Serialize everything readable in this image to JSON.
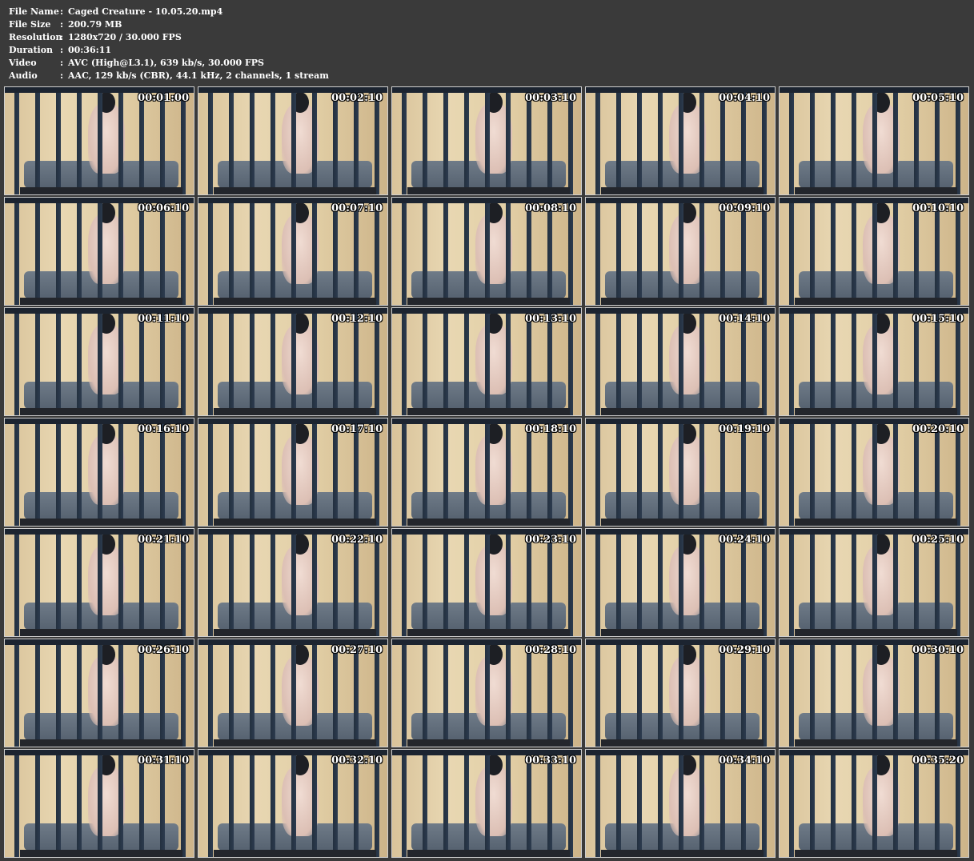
{
  "info": [
    {
      "key": "File Name",
      "sep": ":",
      "value": "Caged Creature - 10.05.20.mp4"
    },
    {
      "key": "File Size",
      "sep": ":",
      "value": "200.79 MB"
    },
    {
      "key": "Resolution",
      "sep": ":",
      "value": "1280x720 / 30.000 FPS"
    },
    {
      "key": "Duration",
      "sep": ":",
      "value": "00:36:11"
    },
    {
      "key": "Video",
      "sep": ":",
      "value": "AVC (High@L3.1), 639 kb/s, 30.000 FPS"
    },
    {
      "key": "Audio",
      "sep": ":",
      "value": "AAC, 129 kb/s (CBR), 44.1 kHz, 2 channels, 1 stream"
    }
  ],
  "thumbnails": [
    {
      "timestamp": "00:01:00"
    },
    {
      "timestamp": "00:02:10"
    },
    {
      "timestamp": "00:03:10"
    },
    {
      "timestamp": "00:04:10"
    },
    {
      "timestamp": "00:05:10"
    },
    {
      "timestamp": "00:06:10"
    },
    {
      "timestamp": "00:07:10"
    },
    {
      "timestamp": "00:08:10"
    },
    {
      "timestamp": "00:09:10"
    },
    {
      "timestamp": "00:10:10"
    },
    {
      "timestamp": "00:11:10"
    },
    {
      "timestamp": "00:12:10"
    },
    {
      "timestamp": "00:13:10"
    },
    {
      "timestamp": "00:14:10"
    },
    {
      "timestamp": "00:15:10"
    },
    {
      "timestamp": "00:16:10"
    },
    {
      "timestamp": "00:17:10"
    },
    {
      "timestamp": "00:18:10"
    },
    {
      "timestamp": "00:19:10"
    },
    {
      "timestamp": "00:20:10"
    },
    {
      "timestamp": "00:21:10"
    },
    {
      "timestamp": "00:22:10"
    },
    {
      "timestamp": "00:23:10"
    },
    {
      "timestamp": "00:24:10"
    },
    {
      "timestamp": "00:25:10"
    },
    {
      "timestamp": "00:26:10"
    },
    {
      "timestamp": "00:27:10"
    },
    {
      "timestamp": "00:28:10"
    },
    {
      "timestamp": "00:29:10"
    },
    {
      "timestamp": "00:30:10"
    },
    {
      "timestamp": "00:31:10"
    },
    {
      "timestamp": "00:32:10"
    },
    {
      "timestamp": "00:33:10"
    },
    {
      "timestamp": "00:34:10"
    },
    {
      "timestamp": "00:35:20"
    }
  ],
  "colors": {
    "background": "#3a3a3a",
    "info_text": "#ffffff",
    "thumb_border": "#cfcfcf"
  }
}
